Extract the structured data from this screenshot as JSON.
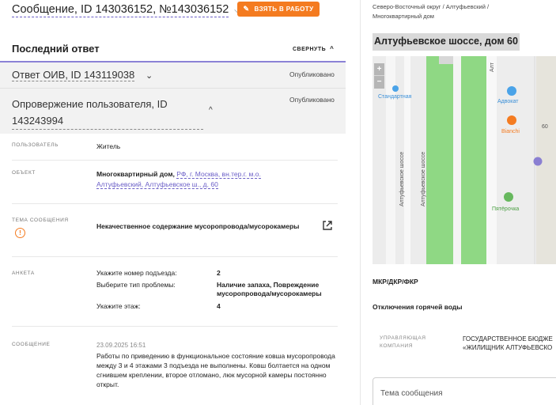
{
  "header": {
    "title": "Сообщение, ID 143036152, №143036152",
    "take_button": "ВЗЯТЬ В РАБОТУ"
  },
  "last_answer": {
    "title": "Последний ответ",
    "collapse_label": "СВЕРНУТЬ"
  },
  "answer": {
    "title": "Ответ ОИВ, ID 143119038",
    "status": "Опубликовано"
  },
  "refutation": {
    "title": "Опровержение пользователя, ID 143243994",
    "status": "Опубликовано"
  },
  "details": {
    "user_label": "ПОЛЬЗОВАТЕЛЬ",
    "user_value": "Житель",
    "object_label": "ОБЪЕКТ",
    "object_type": "Многоквартирный дом,",
    "object_address": "РФ, г. Москва, вн.тер.г. м.о. Алтуфьевский, Алтуфьевское ш., д. 60",
    "topic_label": "ТЕМА СООБЩЕНИЯ",
    "topic_value": "Некачественное содержание мусоропровода/мусорокамеры",
    "form_label": "АНКЕТА",
    "form_rows": [
      {
        "q": "Укажите номер подъезда:",
        "a": "2"
      },
      {
        "q": "Выберите тип проблемы:",
        "a": "Наличие запаха, Повреждение мусоропровода/мусорокамеры"
      },
      {
        "q": "Укажите этаж:",
        "a": "4"
      }
    ],
    "message_label": "СООБЩЕНИЕ",
    "message_date": "23.09.2025 16:51",
    "message_text": "Работы по приведению в функциональное состояние ковша мусоропровода между 3 и 4 этажами 3 подъезда не выполнены. Ковш болтается на одном сгнившем креплении, второе отломано, люк мусорной камеры постоянно открыт."
  },
  "right": {
    "breadcrumb_line1": "Северо-Восточный округ / Алтуфьевский /",
    "breadcrumb_line2": "Многоквартирный дом",
    "address": "Алтуфьевское шоссе, дом 60",
    "map": {
      "zoom_in": "+",
      "zoom_out": "−",
      "labels": {
        "standard": "Стандартная",
        "advocate": "Адвокат",
        "bianchi": "Bianchi",
        "number": "60",
        "pyaterochka": "Пятёрочка",
        "road_a": "Алтуфьевское шоссе",
        "road_b": "Алтуфьевское шоссе",
        "road_c": "Алт"
      }
    },
    "mkr_title": "МКР/ДКР/ФКР",
    "hot_water_title": "Отключения горячей воды",
    "mgmt_label_1": "УПРАВЛЯЮЩАЯ",
    "mgmt_label_2": "КОМПАНИЯ",
    "mgmt_value_1": "ГОСУДАРСТВЕННОЕ БЮДЖЕ",
    "mgmt_value_2": "«ЖИЛИЩНИК АЛТУФЬЕВСКО",
    "message_placeholder": "Тема сообщения"
  },
  "colors": {
    "accent": "#f47b20",
    "purple": "#6b5fc7",
    "map_green": "#8fd884"
  }
}
